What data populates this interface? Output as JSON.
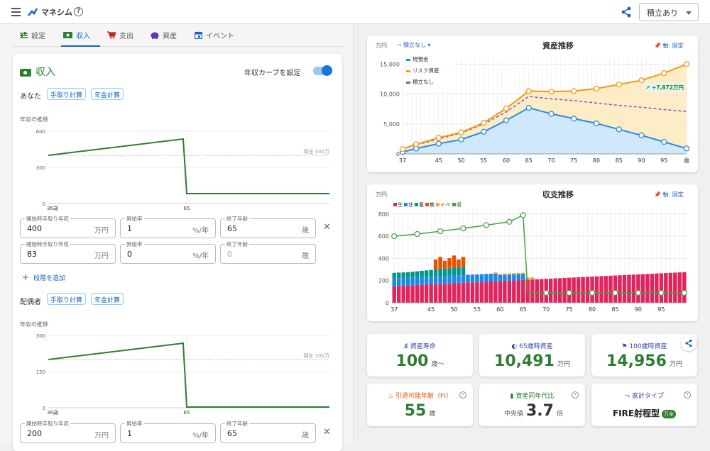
{
  "header": {
    "app_title": "マネシム",
    "plan_select": "積立あり"
  },
  "tabs": [
    {
      "label": "設定"
    },
    {
      "label": "収入"
    },
    {
      "label": "支出"
    },
    {
      "label": "資産"
    },
    {
      "label": "イベント"
    }
  ],
  "income": {
    "title": "収入",
    "toggle_label": "年収カーブを設定",
    "you": {
      "label": "あなた",
      "chip1": "手取り計算",
      "chip2": "年金計算",
      "chart_label": "年収の推移",
      "y_ticks": [
        "600",
        "300",
        "0"
      ],
      "x_ticks": [
        "36歳",
        "65"
      ],
      "current_label": "現在 400万",
      "rows": [
        {
          "start_label": "開始時手取り年収",
          "start_val": "400",
          "start_unit": "万円",
          "rate_label": "昇給率",
          "rate_val": "1",
          "rate_unit": "%/年",
          "end_label": "終了年齢",
          "end_val": "65",
          "end_unit": "歳"
        },
        {
          "start_label": "開始時手取り年収",
          "start_val": "83",
          "start_unit": "万円",
          "rate_label": "昇給率",
          "rate_val": "0",
          "rate_unit": "%/年",
          "end_label": "終了年齢",
          "end_val": "0",
          "end_unit": "歳"
        }
      ],
      "add_label": "段階を追加"
    },
    "spouse": {
      "label": "配偶者",
      "chip1": "手取り計算",
      "chip2": "年金計算",
      "chart_label": "年収の推移",
      "y_ticks": [
        "300",
        "150",
        "0"
      ],
      "x_ticks": [
        "36歳",
        "65"
      ],
      "current_label": "現在 200万",
      "row": {
        "start_label": "開始時手取り年収",
        "start_val": "200",
        "start_unit": "万円",
        "rate_label": "昇給率",
        "rate_val": "1",
        "rate_unit": "%/年",
        "end_label": "終了年齢",
        "end_val": "65",
        "end_unit": "歳"
      }
    }
  },
  "asset_chart": {
    "title": "資産推移",
    "unit": "万円",
    "dropdown": "積立なし",
    "axis_fix": "軸: 固定",
    "legend": [
      "現預金",
      "リスク資産",
      "積立なし"
    ],
    "badge": "+7,872万円",
    "y_ticks": [
      "15,000",
      "10,000",
      "5,000",
      "0"
    ],
    "x_ticks": [
      "37",
      "45",
      "50",
      "55",
      "60",
      "65",
      "70",
      "75",
      "80",
      "85",
      "90",
      "95",
      "歳"
    ]
  },
  "cashflow_chart": {
    "title": "収支推移",
    "unit": "万円",
    "axis_fix": "軸: 固定",
    "legend": [
      "生",
      "住",
      "養",
      "教",
      "イベ",
      "収"
    ],
    "y_ticks": [
      "800",
      "600",
      "400",
      "200",
      "0"
    ],
    "x_ticks": [
      "37",
      "45",
      "50",
      "55",
      "60",
      "65",
      "70",
      "75",
      "80",
      "85",
      "90",
      "95"
    ]
  },
  "stats": [
    {
      "label": "資産寿命",
      "value": "100",
      "unit": "歳〜"
    },
    {
      "label": "65歳時資産",
      "value": "10,491",
      "unit": "万円"
    },
    {
      "label": "100歳時資産",
      "value": "14,956",
      "unit": "万円"
    },
    {
      "label": "引退可能年齢（FI）",
      "value": "55",
      "unit": "歳"
    },
    {
      "label": "資産同年代比",
      "prefix": "中央値",
      "value": "3.7",
      "unit": "倍"
    },
    {
      "label": "家計タイプ",
      "value": "FIRE射程型",
      "badge": "万全"
    }
  ],
  "chart_data": [
    {
      "type": "area",
      "title": "資産推移",
      "x": [
        37,
        40,
        45,
        50,
        55,
        60,
        65,
        70,
        75,
        80,
        85,
        90,
        95,
        100
      ],
      "series": [
        {
          "name": "現預金",
          "values": [
            300,
            900,
            1700,
            2400,
            3700,
            5600,
            7700,
            6700,
            5900,
            5100,
            4100,
            3100,
            2000,
            900
          ]
        },
        {
          "name": "リスク資産",
          "values": [
            800,
            1600,
            2700,
            3600,
            5200,
            7600,
            10500,
            10400,
            10500,
            10900,
            11600,
            12300,
            13500,
            15000
          ]
        },
        {
          "name": "積立なし",
          "values": [
            800,
            1500,
            2500,
            3500,
            5000,
            7000,
            9600,
            9200,
            8900,
            8500,
            8100,
            7800,
            7400,
            7100
          ]
        }
      ],
      "ylim": [
        0,
        16000
      ]
    },
    {
      "type": "bar",
      "title": "収支推移",
      "x_range": [
        37,
        100
      ],
      "expense_series": [
        {
          "name": "生",
          "color": "#e0245e",
          "values": [
            150,
            152,
            154,
            156,
            158,
            160,
            162,
            164,
            166,
            168,
            170,
            172,
            174,
            176,
            178,
            180,
            182,
            184,
            186,
            188,
            190,
            192,
            194,
            196,
            198,
            200,
            202,
            204,
            206,
            208,
            210,
            212,
            214,
            216,
            218,
            220,
            222,
            224,
            226,
            228,
            230,
            232,
            234,
            236,
            238,
            240,
            242,
            244,
            246,
            248,
            250,
            252,
            254,
            256,
            258,
            260,
            262,
            264,
            266,
            268,
            270,
            272,
            274,
            276
          ]
        },
        {
          "name": "住",
          "color": "#1e88e5"
        },
        {
          "name": "養",
          "color": "#009688"
        },
        {
          "name": "教",
          "color": "#e65100"
        },
        {
          "name": "イベ",
          "color": "#f9a825"
        }
      ],
      "income_series": {
        "name": "収",
        "color": "#43a047",
        "x": [
          37,
          42,
          47,
          52,
          57,
          62,
          65,
          66,
          70,
          75,
          80,
          85,
          90,
          95,
          100
        ],
        "values": [
          600,
          620,
          645,
          670,
          700,
          730,
          790,
          90,
          90,
          90,
          90,
          90,
          90,
          90,
          90
        ]
      },
      "ylim": [
        0,
        850
      ]
    }
  ]
}
